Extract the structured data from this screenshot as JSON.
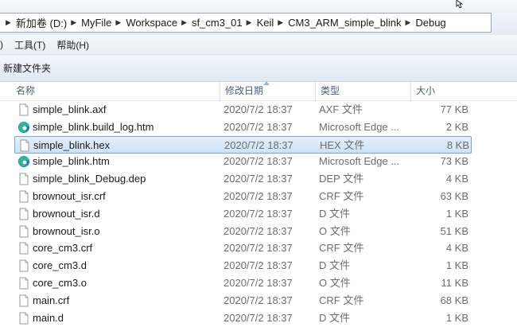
{
  "address_bar": {
    "crumbs": [
      "新加卷 (D:)",
      "MyFile",
      "Workspace",
      "sf_cm3_01",
      "Keil",
      "CM3_ARM_simple_blink",
      "Debug"
    ]
  },
  "menu": {
    "partial_left": ")",
    "items": [
      "工具(T)",
      "帮助(H)"
    ]
  },
  "toolbar": {
    "new_folder_label": "新建文件夹"
  },
  "columns": {
    "name": "名称",
    "date": "修改日期",
    "type": "类型",
    "size": "大小"
  },
  "files": [
    {
      "name": "simple_blink.axf",
      "date": "2020/7/2 18:37",
      "type": "AXF 文件",
      "size": "77 KB",
      "icon": "file-icon",
      "selected": false
    },
    {
      "name": "simple_blink.build_log.htm",
      "date": "2020/7/2 18:37",
      "type": "Microsoft Edge ...",
      "size": "2 KB",
      "icon": "edge-icon",
      "selected": false
    },
    {
      "name": "simple_blink.hex",
      "date": "2020/7/2 18:37",
      "type": "HEX 文件",
      "size": "8 KB",
      "icon": "file-icon",
      "selected": true
    },
    {
      "name": "simple_blink.htm",
      "date": "2020/7/2 18:37",
      "type": "Microsoft Edge ...",
      "size": "73 KB",
      "icon": "edge-icon",
      "selected": false
    },
    {
      "name": "simple_blink_Debug.dep",
      "date": "2020/7/2 18:37",
      "type": "DEP 文件",
      "size": "4 KB",
      "icon": "file-icon",
      "selected": false
    },
    {
      "name": "brownout_isr.crf",
      "date": "2020/7/2 18:37",
      "type": "CRF 文件",
      "size": "63 KB",
      "icon": "file-icon",
      "selected": false
    },
    {
      "name": "brownout_isr.d",
      "date": "2020/7/2 18:37",
      "type": "D 文件",
      "size": "1 KB",
      "icon": "file-icon",
      "selected": false
    },
    {
      "name": "brownout_isr.o",
      "date": "2020/7/2 18:37",
      "type": "O 文件",
      "size": "51 KB",
      "icon": "file-icon",
      "selected": false
    },
    {
      "name": "core_cm3.crf",
      "date": "2020/7/2 18:37",
      "type": "CRF 文件",
      "size": "4 KB",
      "icon": "file-icon",
      "selected": false
    },
    {
      "name": "core_cm3.d",
      "date": "2020/7/2 18:37",
      "type": "D 文件",
      "size": "1 KB",
      "icon": "file-icon",
      "selected": false
    },
    {
      "name": "core_cm3.o",
      "date": "2020/7/2 18:37",
      "type": "O 文件",
      "size": "11 KB",
      "icon": "file-icon",
      "selected": false
    },
    {
      "name": "main.crf",
      "date": "2020/7/2 18:37",
      "type": "CRF 文件",
      "size": "68 KB",
      "icon": "file-icon",
      "selected": false
    },
    {
      "name": "main.d",
      "date": "2020/7/2 18:37",
      "type": "D 文件",
      "size": "1 KB",
      "icon": "file-icon",
      "selected": false
    }
  ],
  "colors": {
    "selection_bg": "#cde2f7",
    "selection_border": "#7da2ce",
    "header_text": "#4c607a",
    "detail_text": "#6d6d6d",
    "edge_blue": "#0c7bd8",
    "edge_green": "#33c481"
  }
}
